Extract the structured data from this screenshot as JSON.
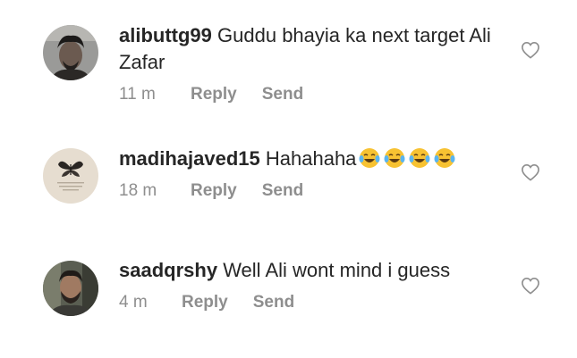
{
  "comments": [
    {
      "username": "alibuttg99",
      "text": "Guddu bhayia ka next target Ali Zafar",
      "time": "11 m",
      "reply_label": "Reply",
      "send_label": "Send",
      "avatar": "man-dark-hair-avatar"
    },
    {
      "username": "madihajaved15",
      "text": "Hahahaha",
      "emoji": [
        "face-with-tears-of-joy",
        "face-with-tears-of-joy",
        "face-with-tears-of-joy",
        "face-with-tears-of-joy"
      ],
      "time": "18 m",
      "reply_label": "Reply",
      "send_label": "Send",
      "avatar": "butterfly-avatar"
    },
    {
      "username": "saadqrshy",
      "text": "Well Ali wont mind i guess",
      "time": "4 m",
      "reply_label": "Reply",
      "send_label": "Send",
      "avatar": "man-beard-avatar"
    }
  ],
  "icons": {
    "like": "heart-outline-icon"
  },
  "colors": {
    "text": "#262626",
    "meta": "#8e8e8e",
    "heart": "#8e8e8e",
    "emoji_face": "#f7c232"
  }
}
